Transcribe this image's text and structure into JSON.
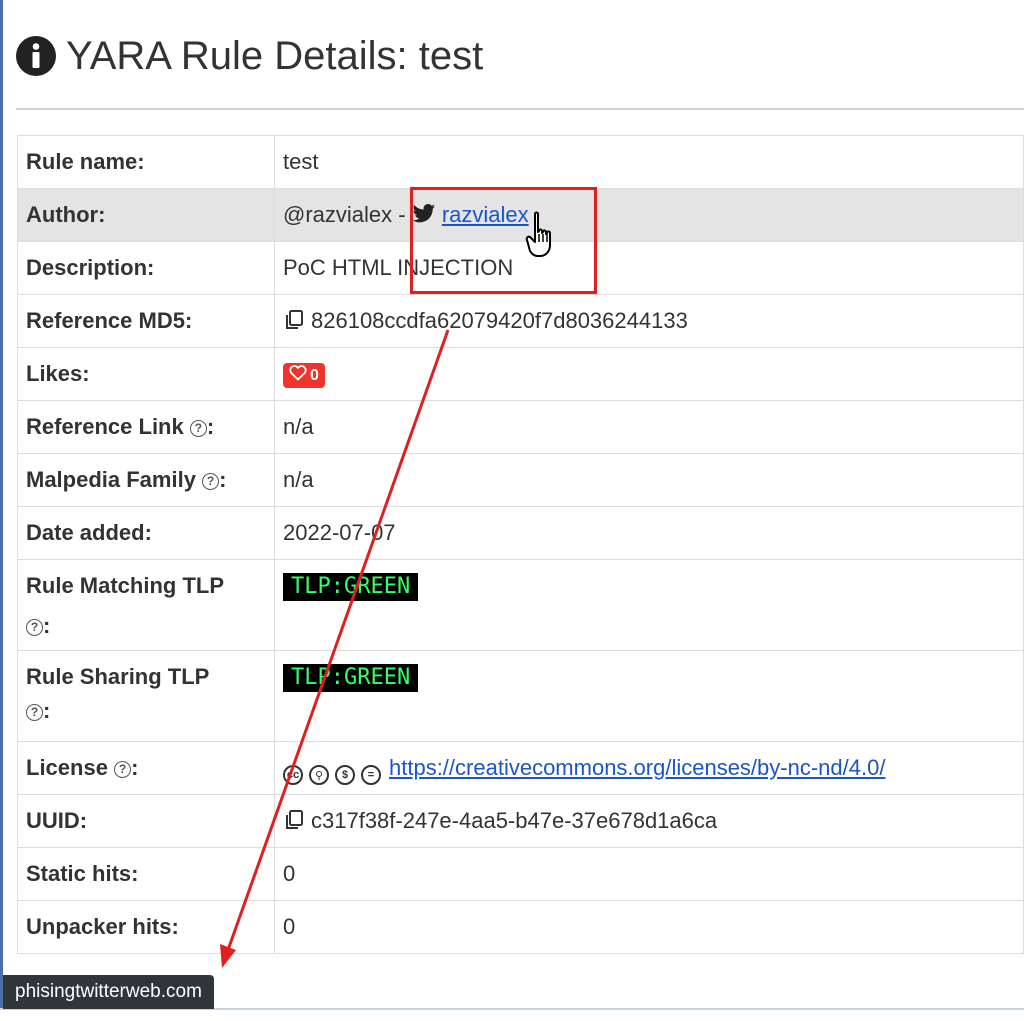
{
  "title": {
    "icon": "info-circle-icon",
    "text": "YARA Rule Details: test"
  },
  "rows": {
    "rule_name": {
      "label": "Rule name:",
      "value": "test"
    },
    "author": {
      "label": "Author:",
      "handle": "@razvialex",
      "separator": " - ",
      "twitter_icon": "twitter-bird-icon",
      "twitter_link": "razvialex"
    },
    "description": {
      "label": "Description:",
      "value": "PoC HTML INJECTION"
    },
    "reference_md5": {
      "label": "Reference MD5:",
      "copy_icon": "copy-icon",
      "value": "826108ccdfa62079420f7d8036244133"
    },
    "likes": {
      "label": "Likes:",
      "icon": "heart-icon",
      "count": "0"
    },
    "reference_link": {
      "label": "Reference Link",
      "suffix": ":",
      "help_icon": "question-circle-icon",
      "value": "n/a"
    },
    "malpedia_family": {
      "label": "Malpedia Family",
      "suffix": ":",
      "help_icon": "question-circle-icon",
      "value": "n/a"
    },
    "date_added": {
      "label": "Date added:",
      "value": "2022-07-07"
    },
    "rule_matching_tlp": {
      "label": "Rule Matching TLP",
      "suffix": ":",
      "help_icon": "question-circle-icon",
      "value": "TLP:GREEN"
    },
    "rule_sharing_tlp": {
      "label": "Rule Sharing TLP",
      "suffix": ":",
      "help_icon": "question-circle-icon",
      "value": "TLP:GREEN"
    },
    "license": {
      "label": "License",
      "suffix": ":",
      "help_icon": "question-circle-icon",
      "cc_icons": [
        "cc-icon",
        "cc-by-icon",
        "cc-nc-icon",
        "cc-nd-icon"
      ],
      "value": "https://creativecommons.org/licenses/by-nc-nd/4.0/"
    },
    "uuid": {
      "label": "UUID:",
      "copy_icon": "copy-icon",
      "value": "c317f38f-247e-4aa5-b47e-37e678d1a6ca"
    },
    "static_hits": {
      "label": "Static hits:",
      "value": "0"
    },
    "unpacker_hits": {
      "label": "Unpacker hits:",
      "value": "0"
    }
  },
  "status_bar": {
    "url": "phisingtwitterweb.com"
  },
  "colors": {
    "annotation_red": "#e02020",
    "likes_red": "#f0342d",
    "tlp_green": "#33ff66",
    "link_blue": "#1a56c9",
    "tooltip_bg": "#2f353b"
  }
}
